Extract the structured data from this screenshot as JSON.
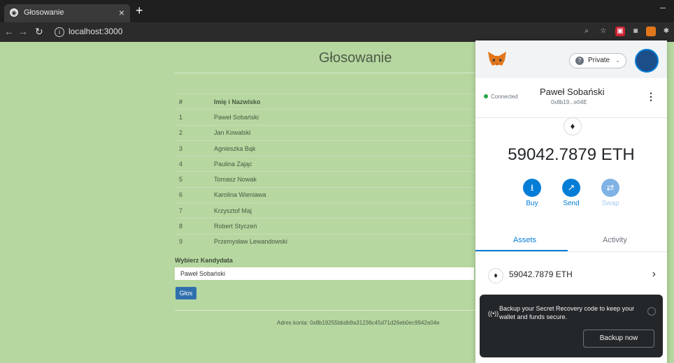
{
  "browser": {
    "tab_title": "Głosowanie",
    "tab_close": "×",
    "new_tab": "+",
    "url": "localhost:3000"
  },
  "page": {
    "heading": "Głosowanie",
    "table": {
      "headers": [
        "#",
        "Imię i Nazwisko"
      ],
      "rows": [
        [
          "1",
          "Paweł Sobański"
        ],
        [
          "2",
          "Jan Kowalski"
        ],
        [
          "3",
          "Agnieszka Bąk"
        ],
        [
          "4",
          "Paulina Zając"
        ],
        [
          "5",
          "Tomasz Nowak"
        ],
        [
          "6",
          "Karolina Wieniawa"
        ],
        [
          "7",
          "Krzysztof Maj"
        ],
        [
          "8",
          "Robert Styczeń"
        ],
        [
          "9",
          "Przemysław Lewandowski"
        ]
      ]
    },
    "select_label": "Wybierz Kandydata",
    "selected_candidate": "Paweł Sobański",
    "vote_button": "Głos",
    "account": "Adres konta: 0x8b19255bbdb9a31236c45d71d26eb0ec9942e04e"
  },
  "metamask": {
    "network": "Private",
    "connection": "Connected",
    "account_name": "Paweł Sobański",
    "account_address": "0x8b19...e04E",
    "balance": "59042.7879 ETH",
    "actions": [
      {
        "label": "Buy",
        "icon": "download-icon"
      },
      {
        "label": "Send",
        "icon": "arrow-up-right-icon"
      },
      {
        "label": "Swap",
        "icon": "swap-icon"
      }
    ],
    "tabs": [
      "Assets",
      "Activity"
    ],
    "asset_value": "59042.7879 ETH",
    "backup_message": "Backup your Secret Recovery code to keep your wallet and funds secure.",
    "backup_button": "Backup now",
    "accent_color": "#037dd6"
  }
}
